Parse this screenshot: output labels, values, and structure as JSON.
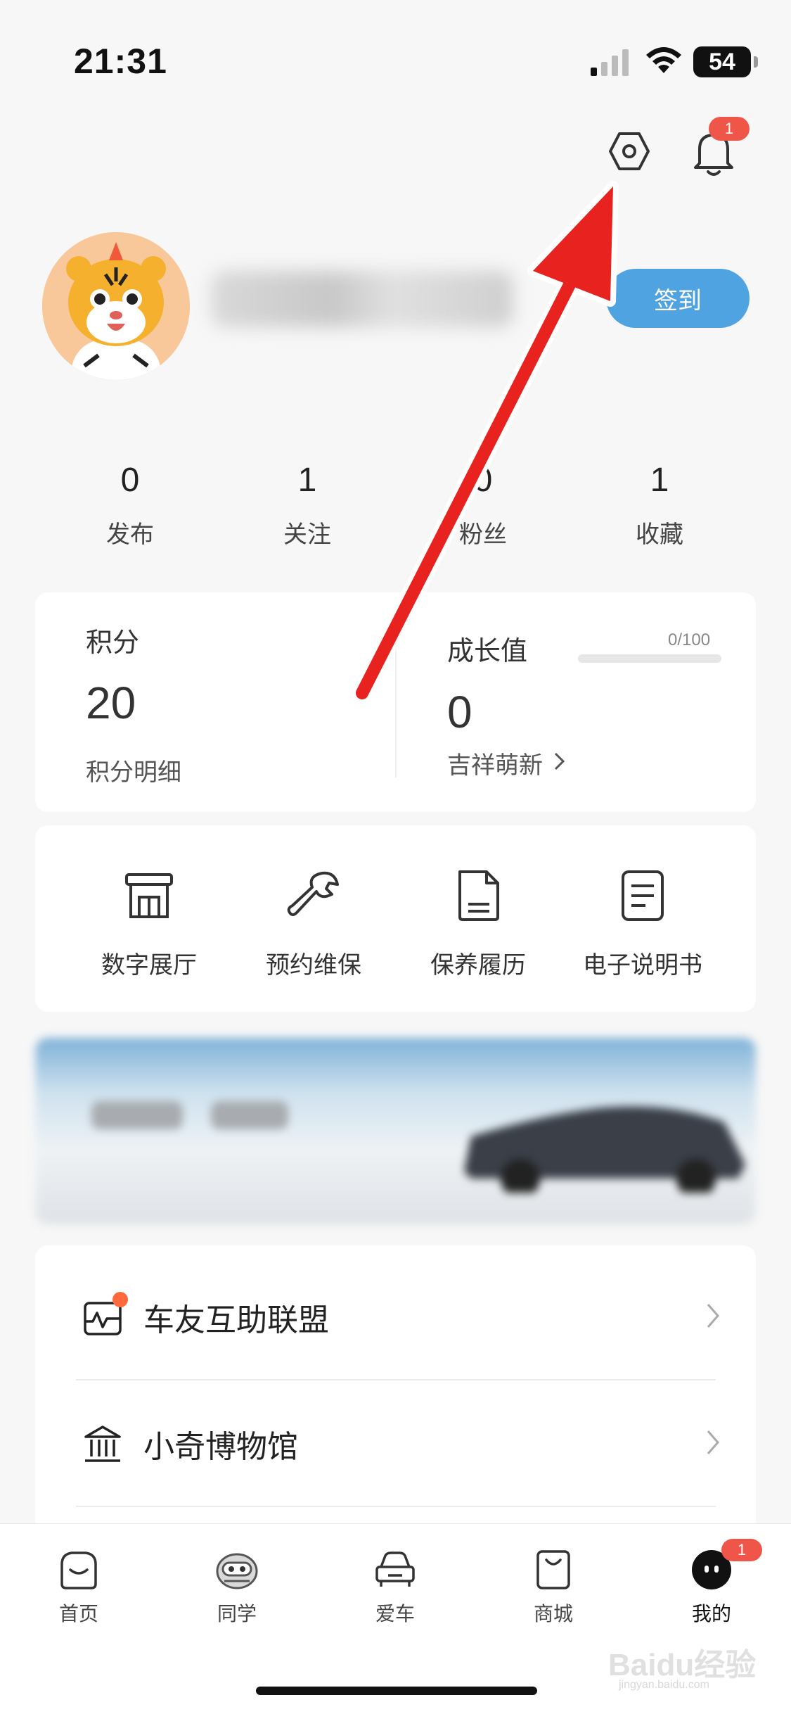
{
  "status_bar": {
    "time": "21:31",
    "battery": "54"
  },
  "header": {
    "notification_count": "1"
  },
  "profile": {
    "signin_label": "签到"
  },
  "stats": [
    {
      "value": "0",
      "label": "发布"
    },
    {
      "value": "1",
      "label": "关注"
    },
    {
      "value": "0",
      "label": "粉丝"
    },
    {
      "value": "1",
      "label": "收藏"
    }
  ],
  "points": {
    "title": "积分",
    "value": "20",
    "detail_link": "积分明细"
  },
  "growth": {
    "title": "成长值",
    "value": "0",
    "level": "吉祥萌新",
    "progress_text": "0/100",
    "progress": 0
  },
  "services": [
    {
      "label": "数字展厅",
      "icon": "showroom-icon"
    },
    {
      "label": "预约维保",
      "icon": "wrench-icon"
    },
    {
      "label": "保养履历",
      "icon": "document-icon"
    },
    {
      "label": "电子说明书",
      "icon": "manual-icon"
    }
  ],
  "list": [
    {
      "label": "车友互助联盟",
      "icon": "heartbeat-card-icon"
    },
    {
      "label": "小奇博物馆",
      "icon": "museum-icon"
    }
  ],
  "tabs": [
    {
      "label": "首页",
      "icon": "home-icon"
    },
    {
      "label": "同学",
      "icon": "friend-icon"
    },
    {
      "label": "爱车",
      "icon": "car-icon"
    },
    {
      "label": "商城",
      "icon": "shopping-bag-icon"
    },
    {
      "label": "我的",
      "icon": "profile-face-icon"
    }
  ],
  "tab_badge": "1",
  "watermark": {
    "brand": "Baidu经验",
    "url": "jingyan.baidu.com"
  },
  "colors": {
    "accent": "#4fa3e0",
    "badge": "#f0554a",
    "arrow": "#e8231f"
  }
}
